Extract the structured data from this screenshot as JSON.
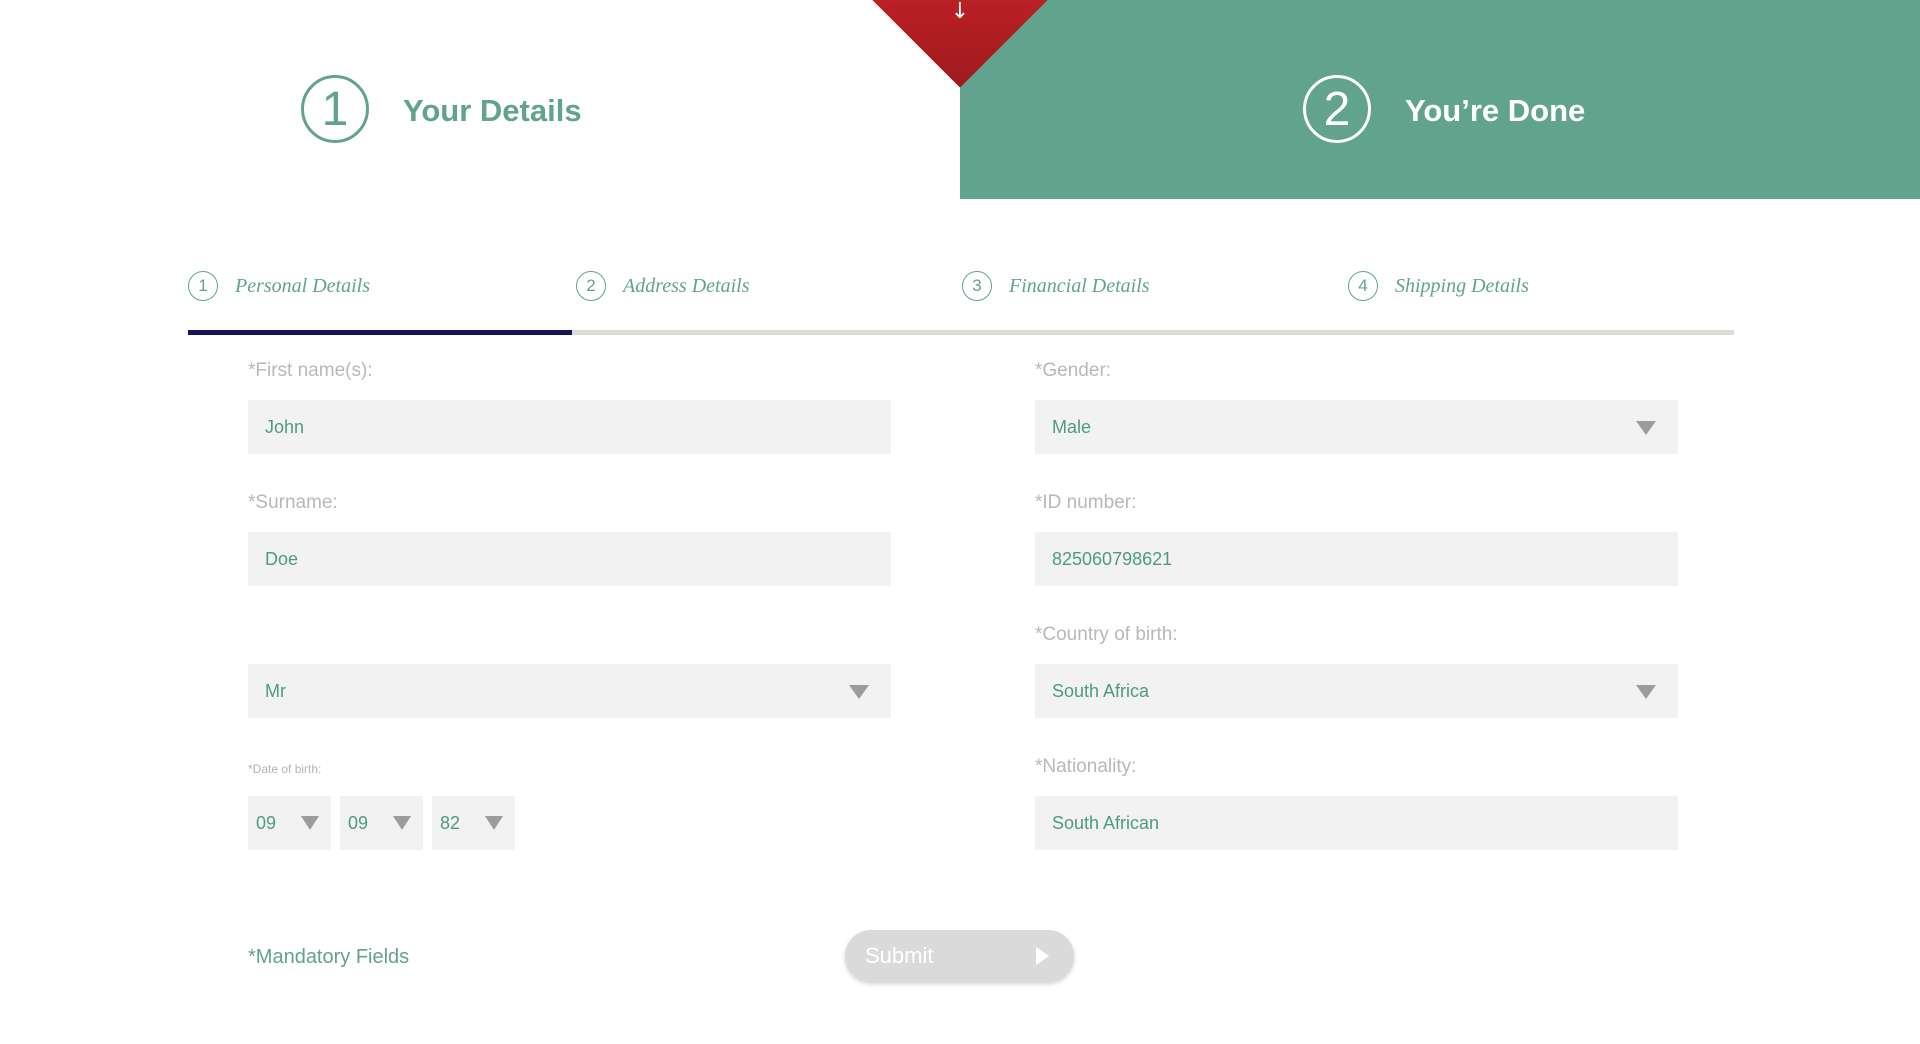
{
  "steps": [
    {
      "number": "1",
      "title": "Your Details"
    },
    {
      "number": "2",
      "title": "You’re Done"
    }
  ],
  "colors": {
    "accent": "#62a38d",
    "active_tab_bar": "#14145a",
    "marker": "#b81f24"
  },
  "tabs": [
    {
      "number": "1",
      "label": "Personal Details"
    },
    {
      "number": "2",
      "label": "Address Details"
    },
    {
      "number": "3",
      "label": "Financial Details"
    },
    {
      "number": "4",
      "label": "Shipping Details"
    }
  ],
  "form": {
    "first_name": {
      "label": "*First name(s):",
      "value": "John"
    },
    "surname": {
      "label": "*Surname:",
      "value": "Doe"
    },
    "title": {
      "value": "Mr"
    },
    "dob": {
      "label": "*Date of birth:",
      "day": "09",
      "month": "09",
      "year": "82"
    },
    "gender": {
      "label": "*Gender:",
      "value": "Male"
    },
    "id_number": {
      "label": "*ID number:",
      "value": "825060798621"
    },
    "country_of_birth": {
      "label": "*Country of birth:",
      "value": "South Africa"
    },
    "nationality": {
      "label": "*Nationality:",
      "value": "South African"
    }
  },
  "footer": {
    "mandatory_note": "*Mandatory Fields",
    "submit_label": "Submit"
  }
}
